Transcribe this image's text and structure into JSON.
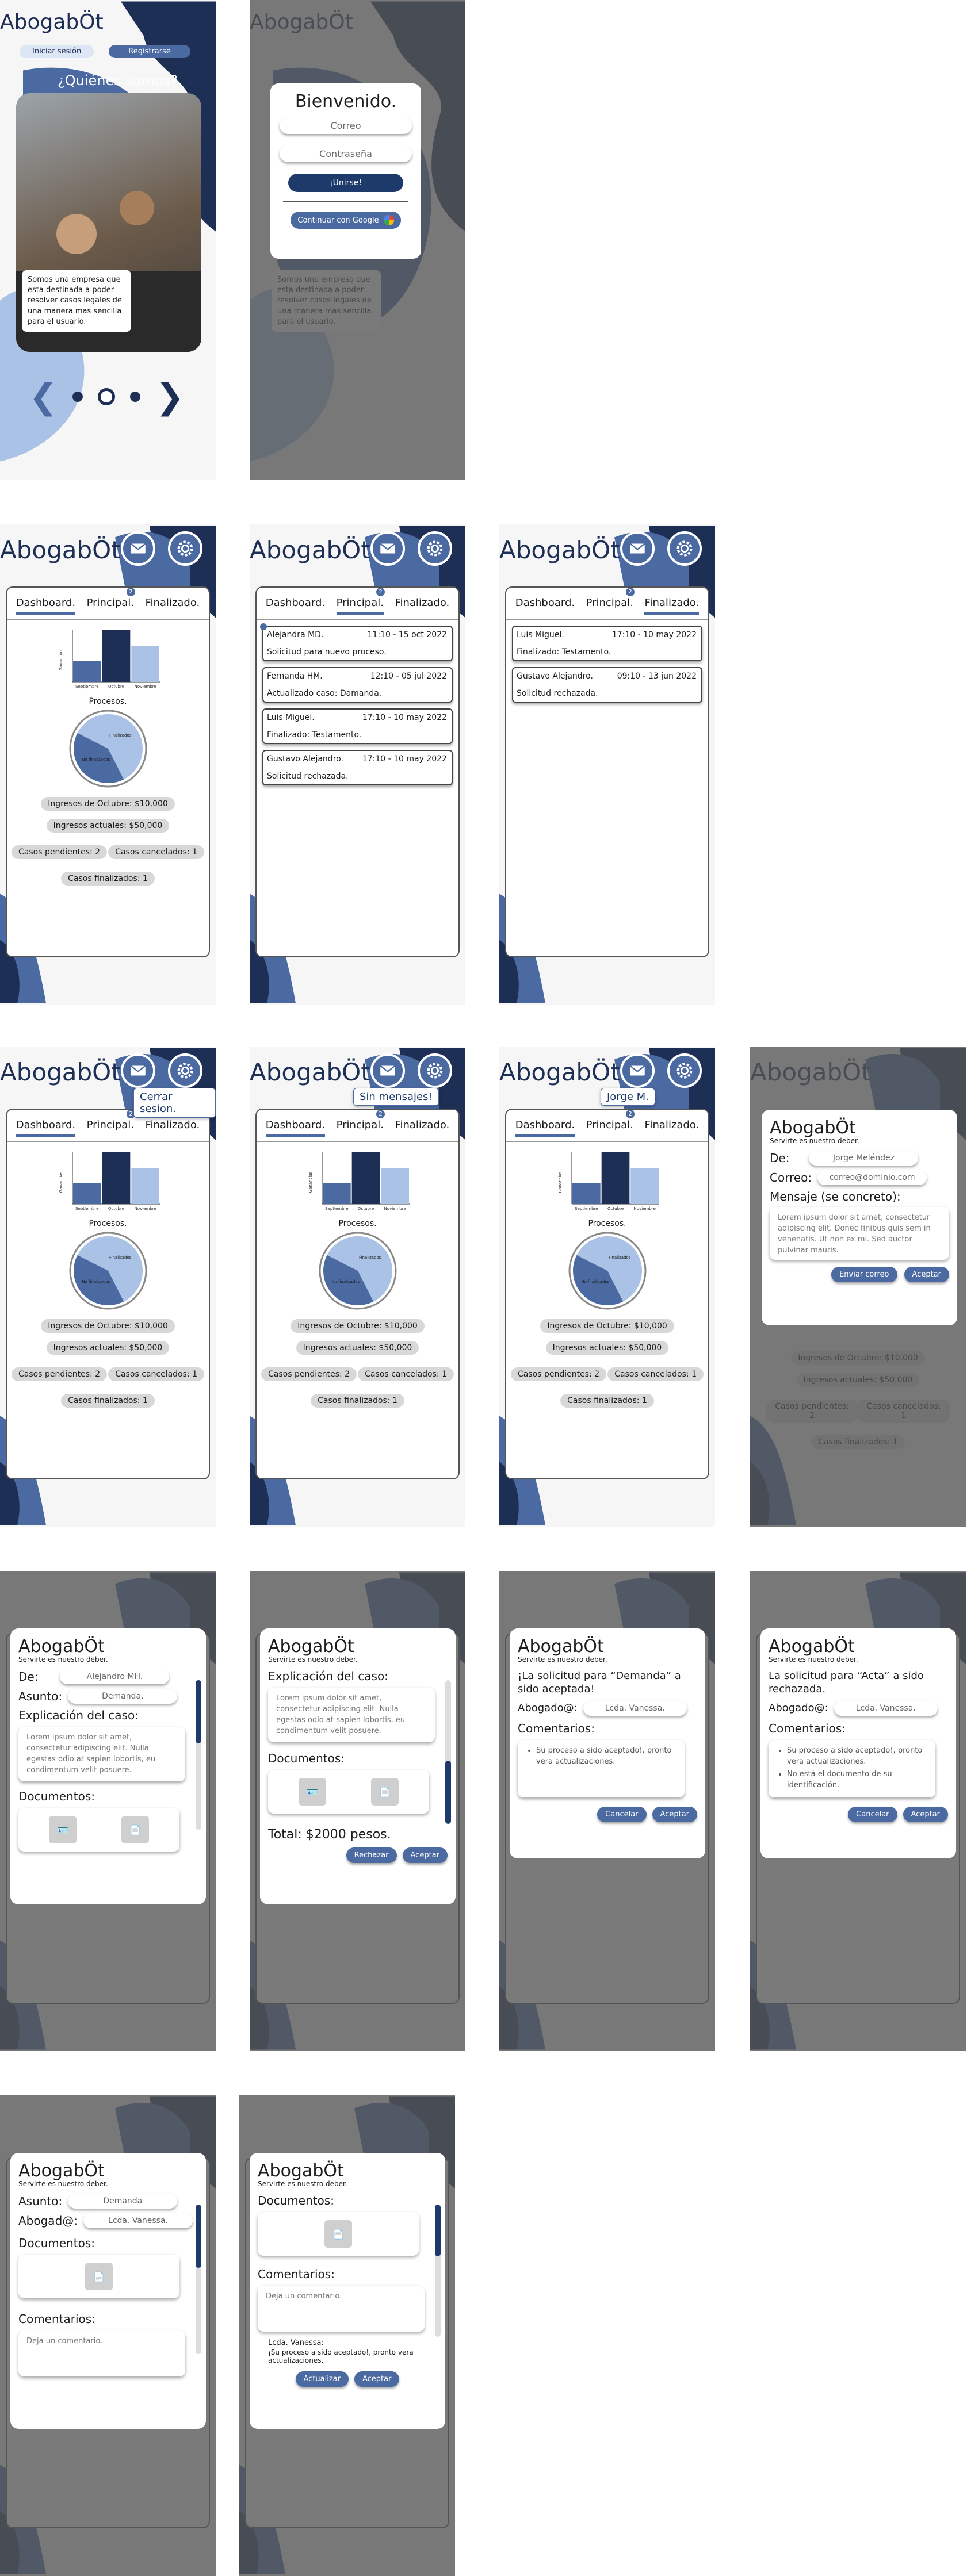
{
  "app": {
    "brand": "AbogabÖt",
    "tagline": "Servirte es nuestro deber."
  },
  "colors": {
    "navy": "#1e2f55",
    "blue": "#4b6aa2",
    "light_blue": "#a9c2e6",
    "gray": "#5a5a5a"
  },
  "landing": {
    "login": "Iniciar sesión",
    "register": "Registrarse",
    "about_title": "¿Quiénes somos?",
    "about_text": "Somos una empresa que esta destinada a poder resolver casos legales de una manera mas sencilla para el usuario."
  },
  "login_modal": {
    "title": "Bienvenido.",
    "email_placeholder": "Correo",
    "password_placeholder": "Contraseña",
    "join": "¡Unirse!",
    "google": "Continuar con Google"
  },
  "tabs": {
    "dashboard": "Dashboard.",
    "principal": "Principal.",
    "finalizado": "Finalizado.",
    "badge": "2"
  },
  "dashboard": {
    "ylabel": "Ganancias",
    "processes_title": "Procesos.",
    "income_october": "Ingresos de Octubre: $10,000",
    "income_current": "Ingresos actuales: $50,000",
    "pending": "Casos pendientes: 2",
    "cancelled": "Casos cancelados: 1",
    "finished": "Casos finalizados: 1"
  },
  "chart_data": [
    {
      "type": "bar",
      "categories": [
        "Septiembre",
        "Octubre",
        "Noviembre"
      ],
      "values": [
        40,
        100,
        70
      ],
      "ylabel": "Ganancias",
      "ylim": [
        0,
        100
      ]
    },
    {
      "type": "pie",
      "categories": [
        "Finalizados",
        "No finalizados"
      ],
      "values": [
        60,
        40
      ]
    }
  ],
  "principal_list": [
    {
      "name": "Alejandra MD.",
      "time": "11:10 - 15 oct 2022",
      "text": "Solicitud para nuevo proceso."
    },
    {
      "name": "Fernanda HM.",
      "time": "12:10 - 05 jul 2022",
      "text": "Actualizado caso: Damanda."
    },
    {
      "name": "Luis Miguel.",
      "time": "17:10 - 10 may 2022",
      "text": "Finalizado: Testamento."
    },
    {
      "name": "Gustavo Alejandro.",
      "time": "17:10 - 10 may 2022",
      "text": "Solicitud rechazada."
    }
  ],
  "finalizado_list": [
    {
      "name": "Luis Miguel.",
      "time": "17:10 - 10 may 2022",
      "text": "Finalizado: Testamento."
    },
    {
      "name": "Gustavo Alejandro.",
      "time": "09:10 - 13 jun 2022",
      "text": "Solicitud rechazada."
    }
  ],
  "tooltips": {
    "logout": "Cerrar sesion.",
    "no_messages": "Sin mensajes!",
    "user": "Jorge M."
  },
  "contact": {
    "from_label": "De:",
    "from_value": "Jorge Meléndez",
    "email_label": "Correo:",
    "email_value": "correo@dominio.com",
    "message_label": "Mensaje (se concreto):",
    "message_text": "Lorem ipsum dolor sit amet, consectetur adipiscing elit. Donec finibus quis sem in venenatis. Ut non ex mi. Sed auctor pulvinar mauris.",
    "send": "Enviar correo",
    "accept": "Aceptar"
  },
  "case_view": {
    "from_label": "De:",
    "from_value": "Alejandro MH.",
    "subject_label": "Asunto:",
    "subject_value": "Demanda.",
    "explain_label": "Explicación del caso:",
    "explain_text": "Lorem ipsum dolor sit amet, consectetur adipiscing elit. Nulla egestas odio at sapien lobortis, eu condimentum velit posuere.",
    "docs_label": "Documentos:",
    "total": "Total: $2000 pesos.",
    "reject": "Rechazar",
    "accept": "Aceptar"
  },
  "accepted": {
    "title": "¡La solicitud para “Demanda” a sido aceptada!",
    "lawyer_label": "Abogado@:",
    "lawyer_value": "Lcda. Vanessa.",
    "comments_label": "Comentarios:",
    "comments": [
      "Su proceso a sido aceptado!, pronto vera actualizaciones."
    ],
    "cancel": "Cancelar",
    "accept": "Aceptar"
  },
  "rejected": {
    "title": "La solicitud para “Acta” a sido rechazada.",
    "lawyer_label": "Abogado@:",
    "lawyer_value": "Lcda. Vanessa.",
    "comments_label": "Comentarios:",
    "comments": [
      "Su proceso a sido aceptado!, pronto vera actualizaciones.",
      "No está el documento de su identificación."
    ],
    "cancel": "Cancelar",
    "accept": "Aceptar"
  },
  "detail": {
    "subject_label": "Asunto:",
    "subject_value": "Demanda",
    "lawyer_label": "Abogad@:",
    "lawyer_value": "Lcda. Vanessa.",
    "docs_label": "Documentos:",
    "comments_label": "Comentarios:",
    "comment_placeholder": "Deja un comentario.",
    "comment_author": "Lcda. Vanessa:",
    "comment_text": "¡Su proceso a sido aceptado!, pronto vera actualizaciones.",
    "update": "Actualizar",
    "accept": "Aceptar"
  }
}
